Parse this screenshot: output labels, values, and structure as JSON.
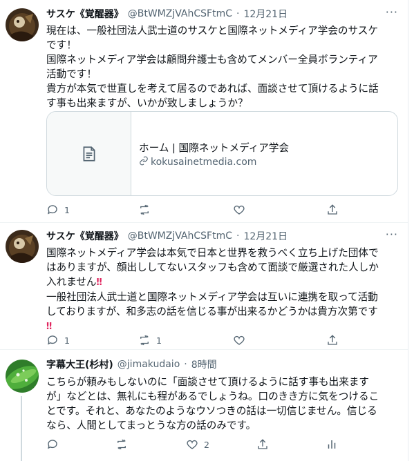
{
  "tweets": [
    {
      "display_name": "サスケ《覚醒器》",
      "handle": "@BtWMZjVAhCSFtmC",
      "date": "12月21日",
      "body_lines": [
        "現在は、一般社団法人武士道のサスケと国際ネットメディア学会のサスケ",
        "です！",
        "国際ネットメディア学会は顧問弁護士も含めてメンバー全員ボランティア",
        "活動です！",
        "貴方が本気で世直しを考えて居るのであれば、面談させて頂けるように話",
        "す事も出来ますが、いかが致しましょうか？"
      ],
      "card": {
        "title": "ホーム | 国際ネットメディア学会",
        "domain": "kokusainetmedia.com"
      },
      "reply_count": "1",
      "retweet_count": "",
      "like_count": ""
    },
    {
      "display_name": "サスケ《覚醒器》",
      "handle": "@BtWMZjVAhCSFtmC",
      "date": "12月21日",
      "body_lines": [
        "国際ネットメディア学会は本気で日本と世界を救うべく立ち上げた団体で",
        "はありますが、顔出ししてないスタッフも含めて面談で厳選された人しか",
        "入れません",
        "一般社団法人武士道と国際ネットメディア学会は互いに連携を取って活動",
        "しておりますが、和多志の話を信じる事が出来るかどうかは貴方次第です",
        ""
      ],
      "reply_count": "1",
      "retweet_count": "1",
      "like_count": ""
    },
    {
      "display_name": "字幕大王(杉村)",
      "handle": "@jimakudaio",
      "date": "8時間",
      "body_lines": [
        "こちらが頼みもしないのに「面談させて頂けるように話す事も出来ます",
        "が」などとは、無礼にも程があるでしょうね。口のきき方に気をつけるこ",
        "とです。それと、あなたのようなウソつきの話は一切信じません。信じる",
        "なら、人間としてまっとうな方の話のみです。"
      ],
      "reply_count": "",
      "retweet_count": "",
      "like_count": "2"
    }
  ],
  "icons": {
    "reply": "reply-icon",
    "retweet": "retweet-icon",
    "like": "heart-icon",
    "share": "share-icon",
    "analytics": "analytics-icon",
    "more": "more-icon",
    "link": "link-icon",
    "card_thumb": "document-icon"
  },
  "colors": {
    "accent": "#1d9bf0",
    "muted": "#536471",
    "border": "#cfd9de",
    "exclamation": "#e0245e"
  }
}
